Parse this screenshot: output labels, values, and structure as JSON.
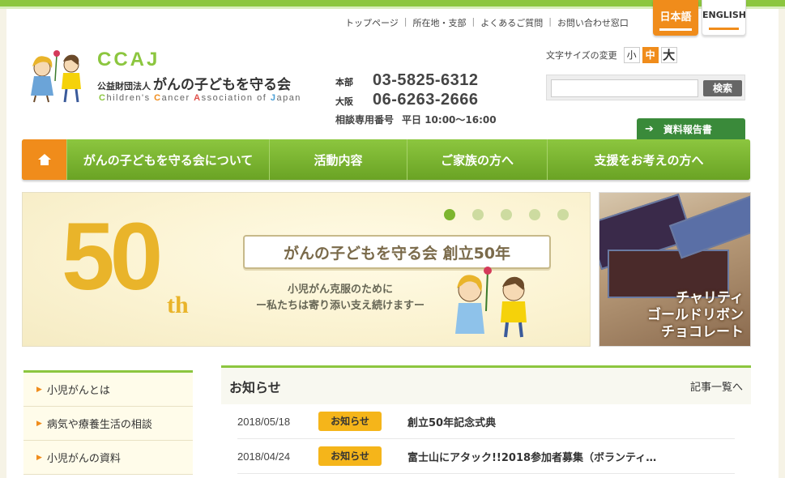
{
  "header": {
    "utility_links": [
      "トップページ",
      "所在地・支部",
      "よくあるご質問",
      "お問い合わせ窓口"
    ],
    "lang": {
      "ja": "日本語",
      "en": "ENGLISH"
    },
    "logo": {
      "ccaj": "CCAJ",
      "org_prefix": "公益財団法人",
      "org_name": "がんの子どもを守る会",
      "en_parts": [
        "C",
        "hildren's ",
        "C",
        "ancer ",
        "A",
        "ssociation of ",
        "J",
        "apan"
      ]
    },
    "contact": {
      "hq_label": "本部",
      "hq_tel": "03-5825-6312",
      "osaka_label": "大阪",
      "osaka_tel": "06-6263-2666",
      "consult_label": "相談専用番号",
      "consult_hours": "平日 10:00〜16:00"
    },
    "font_size": {
      "label": "文字サイズの変更",
      "small": "小",
      "medium": "中",
      "large": "大"
    },
    "search": {
      "placeholder": "",
      "button": "検索"
    },
    "report_button": "資料報告書"
  },
  "nav": {
    "home_icon": "home-icon",
    "items": [
      "がんの子どもを守る会について",
      "活動内容",
      "ご家族の方へ",
      "支援をお考えの方へ"
    ]
  },
  "hero": {
    "number": "50",
    "suffix": "th",
    "headline": "がんの子どもを守る会 創立50年",
    "sub1": "小児がん克服のために",
    "sub2": "ー私たちは寄り添い支え続けますー",
    "slides": 5,
    "active_slide": 1
  },
  "promo": {
    "line1": "チャリティ",
    "line2": "ゴールドリボン",
    "line3": "チョコレート"
  },
  "sidebar": {
    "items": [
      "小児がんとは",
      "病気や療養生活の相談",
      "小児がんの資料"
    ]
  },
  "news": {
    "title": "お知らせ",
    "more": "記事一覧へ",
    "rows": [
      {
        "date": "2018/05/18",
        "badge": "お知らせ",
        "text": "創立50年記念式典"
      },
      {
        "date": "2018/04/24",
        "badge": "お知らせ",
        "text": "富士山にアタック!!2018参加者募集（ボランティ…"
      }
    ]
  },
  "colors": {
    "green": "#8cc63f",
    "orange": "#f08c1b",
    "badge": "#f5b51a"
  }
}
